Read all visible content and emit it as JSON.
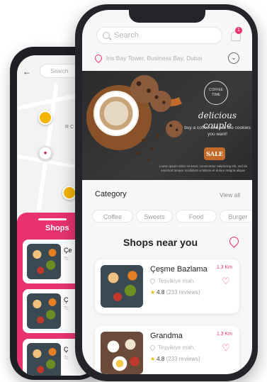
{
  "back_app": {
    "search_placeholder": "Search",
    "map_label": "R C",
    "panel_title": "Shops",
    "cards": [
      {
        "name": "Çe",
        "sub": "Tc"
      },
      {
        "name": "Ç",
        "sub": "Tc"
      },
      {
        "name": "Ç",
        "sub": "Tc"
      }
    ]
  },
  "front_app": {
    "search_placeholder": "Search",
    "notification_count": "1",
    "location": "Iris Bay Tower, Business Bay, Dubai",
    "banner": {
      "brand": "COFFEE TIME",
      "title": "delicious couple",
      "subtitle": "buy a coffee and eat the cookies you want!",
      "tag": "SALE",
      "fine_print": "Lorem ipsum dolor sit amet, consectetur adipiscing elit, sed do eiusmod tempor incididunt ut labore et dolore magna aliqua."
    },
    "category": {
      "title": "Category",
      "view_all": "View all",
      "chips": [
        "Coffee",
        "Sweets",
        "Food",
        "Burger"
      ]
    },
    "shops": {
      "title": "Shops near you",
      "items": [
        {
          "name": "Çeşme Bazlama",
          "location": "Teşvikiye mah.",
          "rating": "4.8",
          "reviews": "(233 reviews)",
          "distance": "1.3 Km"
        },
        {
          "name": "Grandma",
          "location": "Teşvikiye mah.",
          "rating": "4.8",
          "reviews": "(233 reviews)",
          "distance": "1.3 Km"
        }
      ]
    }
  },
  "colors": {
    "accent": "#e8336f",
    "star": "#f4b400"
  }
}
